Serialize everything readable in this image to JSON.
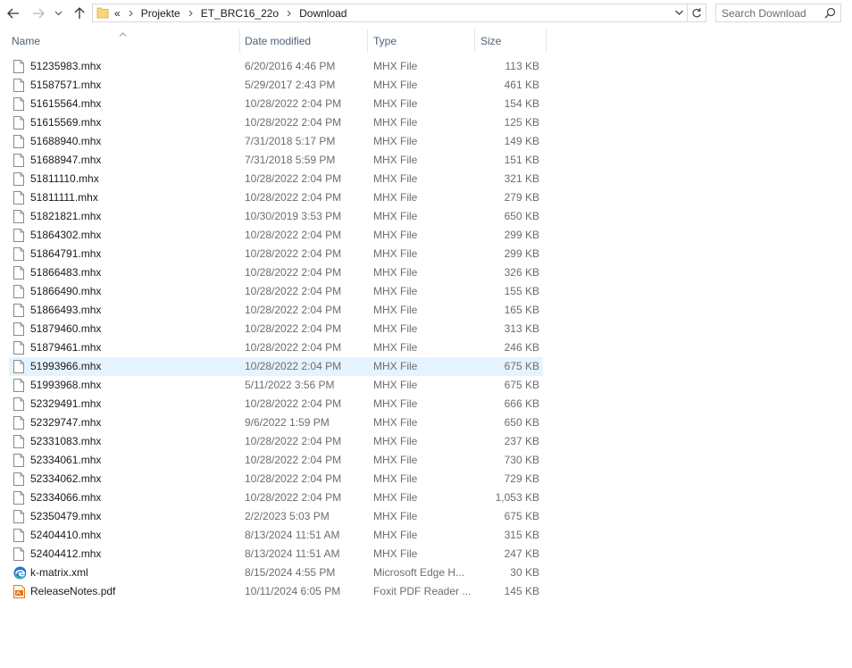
{
  "address_bar": {
    "overflow": "«",
    "crumbs": [
      "Projekte",
      "ET_BRC16_22o",
      "Download"
    ]
  },
  "search": {
    "placeholder": "Search Download"
  },
  "columns": {
    "name": "Name",
    "date": "Date modified",
    "type": "Type",
    "size": "Size"
  },
  "sort": {
    "column": "name",
    "direction": "ascending"
  },
  "files": [
    {
      "name": "51235983.mhx",
      "date": "6/20/2016 4:46 PM",
      "type": "MHX File",
      "size": "113 KB",
      "icon": "generic-file-icon"
    },
    {
      "name": "51587571.mhx",
      "date": "5/29/2017 2:43 PM",
      "type": "MHX File",
      "size": "461 KB",
      "icon": "generic-file-icon"
    },
    {
      "name": "51615564.mhx",
      "date": "10/28/2022 2:04 PM",
      "type": "MHX File",
      "size": "154 KB",
      "icon": "generic-file-icon"
    },
    {
      "name": "51615569.mhx",
      "date": "10/28/2022 2:04 PM",
      "type": "MHX File",
      "size": "125 KB",
      "icon": "generic-file-icon"
    },
    {
      "name": "51688940.mhx",
      "date": "7/31/2018 5:17 PM",
      "type": "MHX File",
      "size": "149 KB",
      "icon": "generic-file-icon"
    },
    {
      "name": "51688947.mhx",
      "date": "7/31/2018 5:59 PM",
      "type": "MHX File",
      "size": "151 KB",
      "icon": "generic-file-icon"
    },
    {
      "name": "51811110.mhx",
      "date": "10/28/2022 2:04 PM",
      "type": "MHX File",
      "size": "321 KB",
      "icon": "generic-file-icon"
    },
    {
      "name": "51811111.mhx",
      "date": "10/28/2022 2:04 PM",
      "type": "MHX File",
      "size": "279 KB",
      "icon": "generic-file-icon"
    },
    {
      "name": "51821821.mhx",
      "date": "10/30/2019 3:53 PM",
      "type": "MHX File",
      "size": "650 KB",
      "icon": "generic-file-icon"
    },
    {
      "name": "51864302.mhx",
      "date": "10/28/2022 2:04 PM",
      "type": "MHX File",
      "size": "299 KB",
      "icon": "generic-file-icon"
    },
    {
      "name": "51864791.mhx",
      "date": "10/28/2022 2:04 PM",
      "type": "MHX File",
      "size": "299 KB",
      "icon": "generic-file-icon"
    },
    {
      "name": "51866483.mhx",
      "date": "10/28/2022 2:04 PM",
      "type": "MHX File",
      "size": "326 KB",
      "icon": "generic-file-icon"
    },
    {
      "name": "51866490.mhx",
      "date": "10/28/2022 2:04 PM",
      "type": "MHX File",
      "size": "155 KB",
      "icon": "generic-file-icon"
    },
    {
      "name": "51866493.mhx",
      "date": "10/28/2022 2:04 PM",
      "type": "MHX File",
      "size": "165 KB",
      "icon": "generic-file-icon"
    },
    {
      "name": "51879460.mhx",
      "date": "10/28/2022 2:04 PM",
      "type": "MHX File",
      "size": "313 KB",
      "icon": "generic-file-icon"
    },
    {
      "name": "51879461.mhx",
      "date": "10/28/2022 2:04 PM",
      "type": "MHX File",
      "size": "246 KB",
      "icon": "generic-file-icon"
    },
    {
      "name": "51993966.mhx",
      "date": "10/28/2022 2:04 PM",
      "type": "MHX File",
      "size": "675 KB",
      "icon": "generic-file-icon",
      "selected": true
    },
    {
      "name": "51993968.mhx",
      "date": "5/11/2022 3:56 PM",
      "type": "MHX File",
      "size": "675 KB",
      "icon": "generic-file-icon"
    },
    {
      "name": "52329491.mhx",
      "date": "10/28/2022 2:04 PM",
      "type": "MHX File",
      "size": "666 KB",
      "icon": "generic-file-icon"
    },
    {
      "name": "52329747.mhx",
      "date": "9/6/2022 1:59 PM",
      "type": "MHX File",
      "size": "650 KB",
      "icon": "generic-file-icon"
    },
    {
      "name": "52331083.mhx",
      "date": "10/28/2022 2:04 PM",
      "type": "MHX File",
      "size": "237 KB",
      "icon": "generic-file-icon"
    },
    {
      "name": "52334061.mhx",
      "date": "10/28/2022 2:04 PM",
      "type": "MHX File",
      "size": "730 KB",
      "icon": "generic-file-icon"
    },
    {
      "name": "52334062.mhx",
      "date": "10/28/2022 2:04 PM",
      "type": "MHX File",
      "size": "729 KB",
      "icon": "generic-file-icon"
    },
    {
      "name": "52334066.mhx",
      "date": "10/28/2022 2:04 PM",
      "type": "MHX File",
      "size": "1,053 KB",
      "icon": "generic-file-icon"
    },
    {
      "name": "52350479.mhx",
      "date": "2/2/2023 5:03 PM",
      "type": "MHX File",
      "size": "675 KB",
      "icon": "generic-file-icon"
    },
    {
      "name": "52404410.mhx",
      "date": "8/13/2024 11:51 AM",
      "type": "MHX File",
      "size": "315 KB",
      "icon": "generic-file-icon"
    },
    {
      "name": "52404412.mhx",
      "date": "8/13/2024 11:51 AM",
      "type": "MHX File",
      "size": "247 KB",
      "icon": "generic-file-icon"
    },
    {
      "name": "k-matrix.xml",
      "date": "8/15/2024 4:55 PM",
      "type": "Microsoft Edge H...",
      "size": "30 KB",
      "icon": "edge-icon"
    },
    {
      "name": "ReleaseNotes.pdf",
      "date": "10/11/2024 6:05 PM",
      "type": "Foxit PDF Reader ...",
      "size": "145 KB",
      "icon": "pdf-icon"
    }
  ],
  "colors": {
    "selected_row": "#e5f3ff",
    "header_text": "#4c607a",
    "folder": "#f8d775",
    "edge": "#1b7ad0",
    "pdf": "#e8731c"
  }
}
